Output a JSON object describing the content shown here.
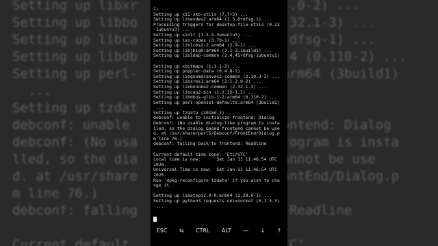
{
  "background_lines": [
    "Setting up libxr",
    "Setting up libbo",
    "Setting up libca",
    "Setting up libdb",
    "Setting up perl-",
    "  ...",
    "Setting up tzdat",
    "debconf: unable",
    "debconf: (No usa",
    "lled, so the dia",
    "d. at /usr/share",
    "m line 76.)",
    "debconf: falling",
    "",
    "Current default"
  ],
  "background_right_lines": [
    "  .0-2) ...",
    "  32.1-3) ...",
    "  dfsg-1) ...",
    "  4 (0.110-2) ...",
    ":arm64 (3build1)",
    "",
    "",
    "rontend: Dialog",
    "program is insta",
    "cannot be use",
    "rontEnd/Dialog.p",
    "",
    ": Readline",
    "",
    "UTC'"
  ],
  "terminal_lines": [
    "1) ...",
    "Setting up x11-xkb-utils (7.7+3) ...",
    "Setting up libevdev2:arm64 (1.5.8+dfsg-1) ...",
    "Processing triggers for desktop-file-utils (0.23",
    "-1ubuntu3) ...",
    "Setting up xinit (1.3.4-3ubuntu3) ...",
    "Setting up iso-codes (3.79-1) ...",
    "Setting up liblcms2-2:arm64 (2.9-1) ...",
    "Setting up libjbig0:arm64 (2.1-3.1build1) ...",
    "Setting up libldap-common (2.4.45+dfsg-1ubuntu1)",
    " ...",
    "Setting up xbitmaps (1.1.1-2) ...",
    "Setting up poppler-data (0.4.8-2) ...",
    "Setting up libgnomecanvas2-common (2.30.3-3) ...",
    "Setting up libxres1:arm64 (2:1.2.0-2) ...",
    "Setting up libbonobo2-common (2.32.1-3) ...",
    "Setting up libcap2-bin (1:2.25-1.2) ...",
    "Setting up libdbus-glib-1-2:arm64 (0.110-2) ...",
    "Setting up perl-openssl-defaults:arm64 (3build1)",
    " ...",
    "Setting up tzdata (2018d-1) ...",
    "debconf: unable to initialize frontend: Dialog",
    "debconf: (No usable dialog-like program is insta",
    "lled, so the dialog based frontend cannot be use",
    "d. at /usr/share/perl5/Debconf/FrontEnd/Dialog.p",
    "m line 76.)",
    "debconf: falling back to frontend: Readline",
    "",
    "Current default time zone: 'Etc/UTC'",
    "Local time is now:      Sat Jan 11 11:46:54 UTC",
    "2020.",
    "Universal Time is now:  Sat Jan 11 11:46:54 UTC",
    "2020.",
    "Run 'dpkg-reconfigure tzdata' if you wish to cha",
    "nge it.",
    "",
    "Setting up libatspi2.0-0:arm64 (2.28.0-1) ...",
    "Setting up python3-requests-unixsocket (0.1.5-3)",
    " ..."
  ],
  "extra_keys": {
    "esc": "ESC",
    "tab": "⇆",
    "ctrl": "CTRL",
    "alt": "ALT",
    "dash": "—",
    "down": "↓",
    "up": "↑"
  }
}
